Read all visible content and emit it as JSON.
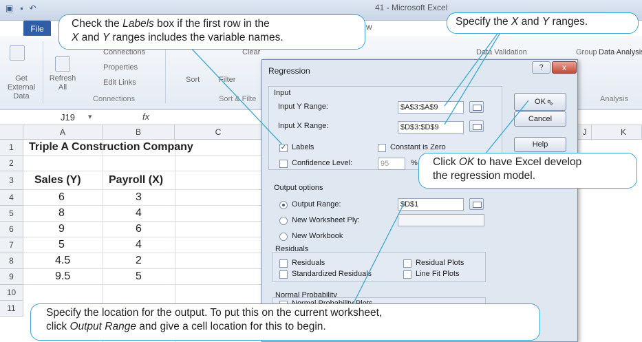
{
  "window": {
    "title": "41 - Microsoft Excel",
    "file_tab": "File",
    "view_tab": "w"
  },
  "ribbon": {
    "get_external_data": "Get External Data",
    "refresh_all": "Refresh All",
    "connections": "Connections",
    "properties": "Properties",
    "edit_links": "Edit Links",
    "connections_group": "Connections",
    "sort": "Sort",
    "filter": "Filter",
    "clear": "Clear",
    "sort_filter_group": "Sort & Filte",
    "data_validation": "Data Validation",
    "group": "Group",
    "data_analysis": "Data Analysis",
    "analysis_group": "Analysis"
  },
  "formula_bar": {
    "name_box": "J19",
    "fx": "fx"
  },
  "grid": {
    "columns": [
      "A",
      "B",
      "C",
      "J",
      "K"
    ],
    "rows": [
      "1",
      "2",
      "3",
      "4",
      "5",
      "6",
      "7",
      "8",
      "9",
      "10",
      "11"
    ],
    "title": "Triple A Construction Company",
    "header_sales": "Sales (Y)",
    "header_payroll": "Payroll (X)",
    "sales": [
      "6",
      "8",
      "9",
      "5",
      "4.5",
      "9.5"
    ],
    "payroll": [
      "3",
      "4",
      "6",
      "4",
      "2",
      "5"
    ]
  },
  "dialog": {
    "title": "Regression",
    "help_glyph": "?",
    "close_glyph": "x",
    "input_label": "Input",
    "input_y_label": "Input Y Range:",
    "input_y_value": "$A$3:$A$9",
    "input_x_label": "Input X Range:",
    "input_x_value": "$D$3:$D$9",
    "labels_label": "Labels",
    "constant_zero_label": "Constant is Zero",
    "confidence_label": "Confidence Level:",
    "confidence_value": "95",
    "percent": "%",
    "ok": "OK",
    "cancel": "Cancel",
    "help": "Help",
    "output_options_label": "Output options",
    "output_range_label": "Output Range:",
    "output_range_value": "$D$1",
    "new_worksheet_label": "New Worksheet Ply:",
    "new_workbook_label": "New Workbook",
    "residuals_group": "Residuals",
    "residuals_label": "Residuals",
    "std_residuals_label": "Standardized Residuals",
    "residual_plots_label": "Residual Plots",
    "line_fit_label": "Line Fit Plots",
    "normal_prob_group": "Normal Probability",
    "normal_prob_plots": "Normal Probability Plots"
  },
  "callouts": {
    "labels_1a": "Check the ",
    "labels_1b": "Labels",
    "labels_1c": " box if the first row in the",
    "labels_2a": "X",
    "labels_2b": " and ",
    "labels_2c": "Y",
    "labels_2d": " ranges  includes the variable names.",
    "ranges_1": "Specify the ",
    "ranges_x": "X",
    "ranges_and": " and ",
    "ranges_y": "Y",
    "ranges_2": " ranges.",
    "ok_1": "Click ",
    "ok_it": "OK",
    "ok_2": " to have Excel develop",
    "ok_3": "the regression model.",
    "out_1": "Specify the location for the output. To put this on the current worksheet,",
    "out_2a": "click ",
    "out_2it": "Output Range",
    "out_2b": " and give a cell location for this to begin."
  },
  "colors": {
    "callout_border": "#3aa6d8",
    "file_tab": "#2f5da6",
    "dialog_bg": "#dfe7f1"
  }
}
